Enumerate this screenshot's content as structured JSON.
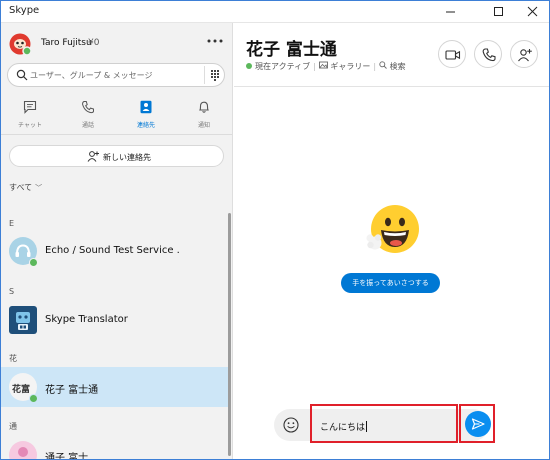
{
  "window": {
    "title": "Skype"
  },
  "profile": {
    "name": "Taro Fujitsu",
    "credit": "¥0"
  },
  "search": {
    "placeholder": "ユーザー、グループ & メッセージ"
  },
  "tabs": [
    {
      "label": "チャット",
      "icon": "chat-icon",
      "active": false
    },
    {
      "label": "通話",
      "icon": "phone-icon",
      "active": false
    },
    {
      "label": "連絡先",
      "icon": "contacts-icon",
      "active": true
    },
    {
      "label": "通知",
      "icon": "bell-icon",
      "active": false
    }
  ],
  "new_contact_label": "新しい連絡先",
  "filter": {
    "label": "すべて"
  },
  "contacts": {
    "sections": [
      "E",
      "S",
      "花",
      "通"
    ],
    "items": [
      {
        "name": "Echo / Sound Test Service .",
        "status": "online"
      },
      {
        "name": "Skype Translator"
      },
      {
        "name": "花子 富士通",
        "avatar_text": "花富",
        "status": "online",
        "selected": true
      },
      {
        "name": "通子 富士"
      }
    ]
  },
  "conversation": {
    "title": "花子 富士通",
    "status": "現在アクティブ",
    "gallery_label": "ギャラリー",
    "search_label": "検索",
    "greet_button": "手を振ってあいさつする",
    "message_text": "こんにちは"
  },
  "colors": {
    "accent": "#0078d4",
    "presence": "#5cb85c",
    "selection": "#cde6f7",
    "highlight": "#e0202a"
  }
}
